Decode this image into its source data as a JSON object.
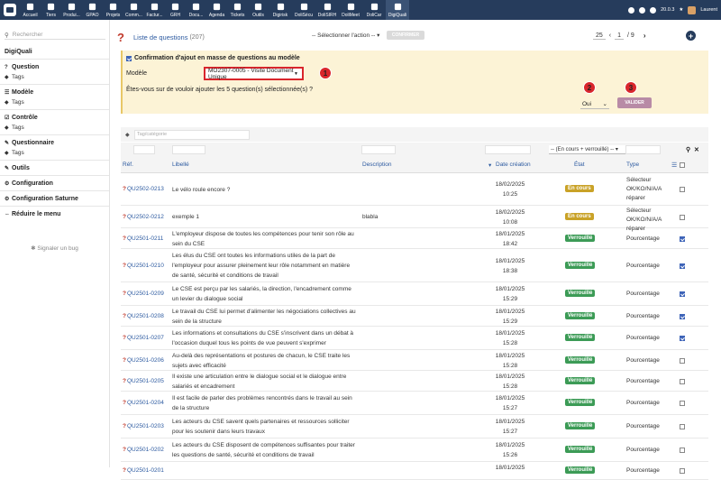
{
  "topbar": {
    "modules": [
      {
        "label": "Accueil",
        "icon": "home-icon"
      },
      {
        "label": "Tiers",
        "icon": "building-icon"
      },
      {
        "label": "Produi...",
        "icon": "cube-icon"
      },
      {
        "label": "GPAO",
        "icon": "cogs-icon"
      },
      {
        "label": "Projets",
        "icon": "sitemap-icon"
      },
      {
        "label": "Comm...",
        "icon": "suitcase-icon"
      },
      {
        "label": "Factur...",
        "icon": "invoice-icon"
      },
      {
        "label": "GRH",
        "icon": "users-icon"
      },
      {
        "label": "Docu...",
        "icon": "folder-icon"
      },
      {
        "label": "Agenda",
        "icon": "calendar-icon"
      },
      {
        "label": "Tickets",
        "icon": "ticket-icon"
      },
      {
        "label": "Outils",
        "icon": "wrench-icon"
      },
      {
        "label": "Digirisk",
        "icon": "digirisk-icon"
      },
      {
        "label": "DoliSécu",
        "icon": "shield-icon"
      },
      {
        "label": "DoliSIRH",
        "icon": "id-card-icon"
      },
      {
        "label": "DoliMeet",
        "icon": "meeting-icon"
      },
      {
        "label": "DoliCar",
        "icon": "car-icon"
      },
      {
        "label": "DigiQuali",
        "icon": "quality-icon"
      }
    ],
    "version": "20.0.3",
    "user": "Laurent"
  },
  "sidebar": {
    "search_placeholder": "Rechercher",
    "app_title": "DigiQuali",
    "items": [
      {
        "label": "Question",
        "sub": "Tags"
      },
      {
        "label": "Modèle",
        "sub": "Tags"
      },
      {
        "label": "Contrôle",
        "sub": "Tags"
      },
      {
        "label": "Questionnaire",
        "sub": "Tags"
      }
    ],
    "outils": "Outils",
    "configuration": "Configuration",
    "configuration_saturne": "Configuration Saturne",
    "reduce_menu": "Réduire le menu",
    "report_bug": "Signaler un bug"
  },
  "header": {
    "title": "Liste de questions",
    "count": "(207)",
    "mass_action": "-- Sélectionner l'action --",
    "confirm_button": "CONFIRMER",
    "page_size": "25",
    "page_current": "1",
    "page_total": "/ 9"
  },
  "confirm_box": {
    "title": "Confirmation d'ajout en masse de questions au modèle",
    "model_label": "Modèle",
    "model_value": "MO2307-0005 - Visite Document Unique",
    "question": "Êtes-vous sur de vouloir ajouter les 5 question(s) sélectionnée(s) ?",
    "answer": "Oui",
    "validate_button": "VALIDER",
    "markers": [
      "1",
      "2",
      "3"
    ]
  },
  "filters": {
    "tag_placeholder": "Tag/catégorie",
    "etat_select": "-- (En cours + verrouillé) --"
  },
  "table": {
    "headers": {
      "ref": "Réf.",
      "libelle": "Libellé",
      "description": "Description",
      "date": "Date création",
      "etat": "État",
      "type": "Type"
    },
    "rows": [
      {
        "ref": "QU2502-0213",
        "libelle": "Le vélo roule encore ?",
        "description": "",
        "date": "18/02/2025",
        "time": "10:25",
        "etat": "En cours",
        "type": "Sélecteur OK/KO/N/A/A réparer",
        "checked": false
      },
      {
        "ref": "QU2502-0212",
        "libelle": "exemple 1",
        "description": "blabla",
        "date": "18/02/2025",
        "time": "10:08",
        "etat": "En cours",
        "type": "Sélecteur OK/KO/N/A/A réparer",
        "checked": false
      },
      {
        "ref": "QU2501-0211",
        "libelle": "L'employeur dispose de toutes les compétences pour tenir son rôle au sein du CSE",
        "description": "",
        "date": "18/01/2025",
        "time": "18:42",
        "etat": "Verrouillé",
        "type": "Pourcentage",
        "checked": true
      },
      {
        "ref": "QU2501-0210",
        "libelle": "Les élus du CSE ont toutes les informations utiles de la part de l'employeur pour assurer pleinement leur rôle notamment en matière de santé, sécurité et conditions de travail",
        "description": "",
        "date": "18/01/2025",
        "time": "18:38",
        "etat": "Verrouillé",
        "type": "Pourcentage",
        "checked": true
      },
      {
        "ref": "QU2501-0209",
        "libelle": "Le CSE est perçu par les salariés, la direction, l'encadrement comme un levier du dialogue social",
        "description": "",
        "date": "18/01/2025",
        "time": "15:29",
        "etat": "Verrouillé",
        "type": "Pourcentage",
        "checked": true
      },
      {
        "ref": "QU2501-0208",
        "libelle": "Le travail du CSE lui permet d'alimenter les négociations collectives au sein de la structure",
        "description": "",
        "date": "18/01/2025",
        "time": "15:29",
        "etat": "Verrouillé",
        "type": "Pourcentage",
        "checked": true
      },
      {
        "ref": "QU2501-0207",
        "libelle": "Les informations et consultations du CSE s'inscrivent dans un débat à l'occasion duquel tous les points de vue peuvent s'exprimer",
        "description": "",
        "date": "18/01/2025",
        "time": "15:28",
        "etat": "Verrouillé",
        "type": "Pourcentage",
        "checked": true
      },
      {
        "ref": "QU2501-0206",
        "libelle": "Au-delà des représentations et postures de chacun, le CSE traite les sujets avec efficacité",
        "description": "",
        "date": "18/01/2025",
        "time": "15:28",
        "etat": "Verrouillé",
        "type": "Pourcentage",
        "checked": false
      },
      {
        "ref": "QU2501-0205",
        "libelle": "Il existe une articulation entre le dialogue social et le dialogue entre salariés et encadrement",
        "description": "",
        "date": "18/01/2025",
        "time": "15:28",
        "etat": "Verrouillé",
        "type": "Pourcentage",
        "checked": false
      },
      {
        "ref": "QU2501-0204",
        "libelle": "Il est facile de parler des problèmes rencontrés dans le travail au sein de la structure",
        "description": "",
        "date": "18/01/2025",
        "time": "15:27",
        "etat": "Verrouillé",
        "type": "Pourcentage",
        "checked": false
      },
      {
        "ref": "QU2501-0203",
        "libelle": "Les acteurs du CSE savent quels partenaires et ressources solliciter pour les soutenir dans leurs travaux",
        "description": "",
        "date": "18/01/2025",
        "time": "15:27",
        "etat": "Verrouillé",
        "type": "Pourcentage",
        "checked": false
      },
      {
        "ref": "QU2501-0202",
        "libelle": "Les acteurs du CSE disposent de compétences suffisantes pour traiter les questions de santé, sécurité et conditions de travail",
        "description": "",
        "date": "18/01/2025",
        "time": "15:26",
        "etat": "Verrouillé",
        "type": "Pourcentage",
        "checked": false
      },
      {
        "ref": "QU2501-0201",
        "libelle": "",
        "description": "",
        "date": "18/01/2025",
        "time": "",
        "etat": "Verrouillé",
        "type": "Pourcentage",
        "checked": false
      }
    ]
  },
  "colors": {
    "topbar": "#263c5c",
    "link": "#2c5aa0",
    "en_cours": "#c9a227",
    "verrouille": "#3c9b56",
    "highlight": "#d9262c",
    "confirm_bg": "#fcf3d6"
  }
}
